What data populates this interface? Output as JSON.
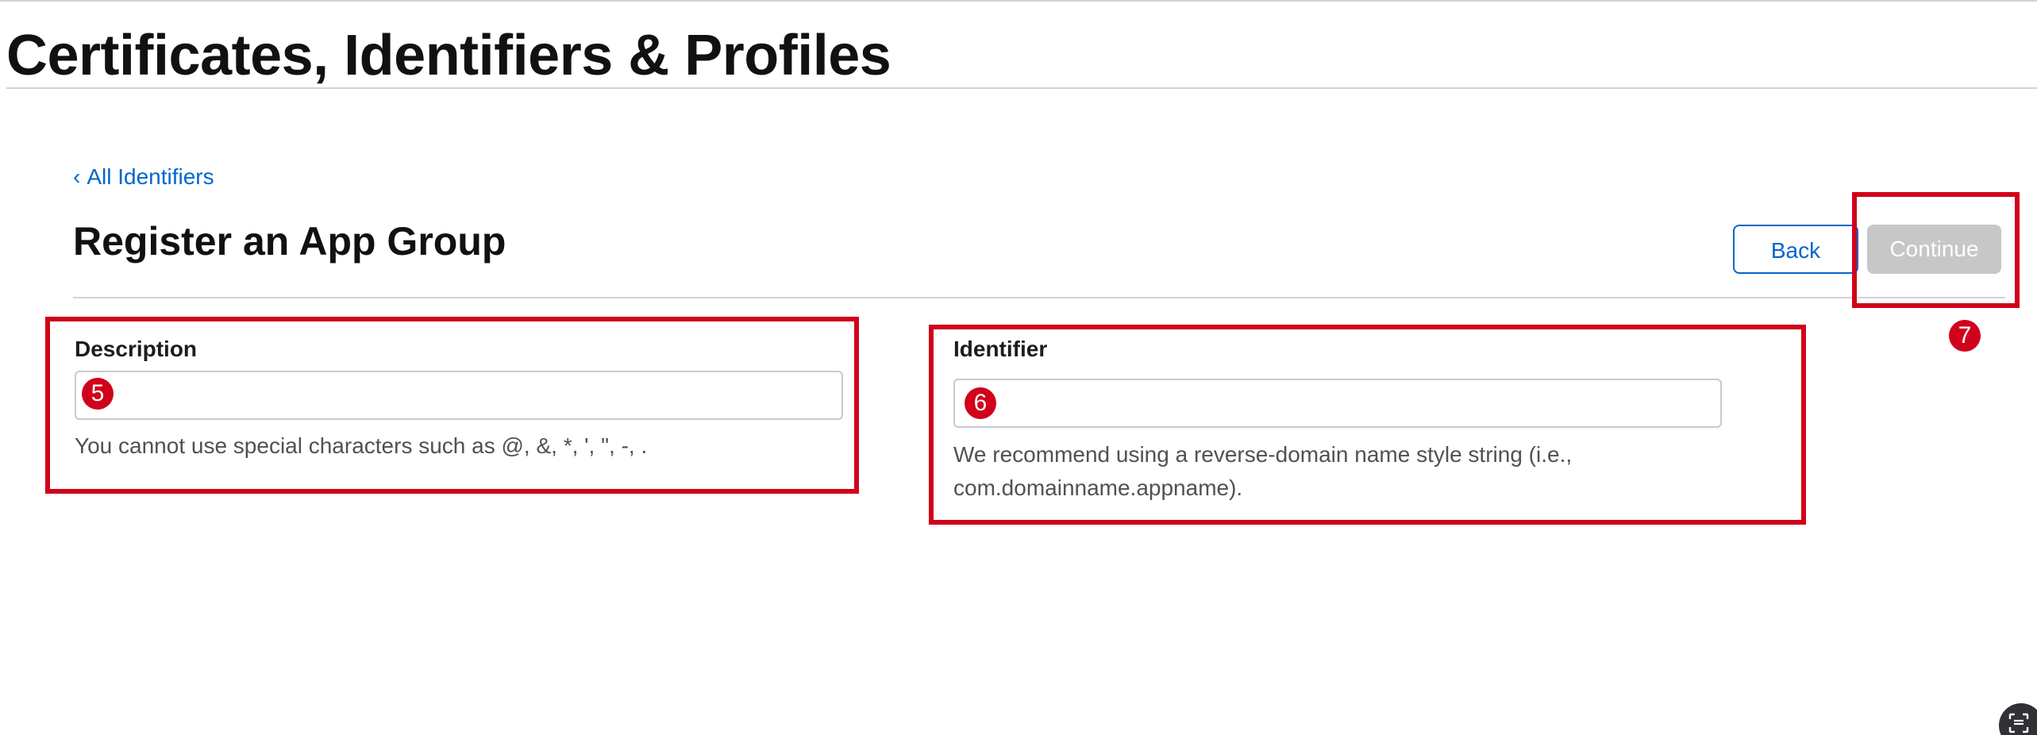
{
  "header": {
    "title": "Certificates, Identifiers & Profiles"
  },
  "nav": {
    "back_link_chevron": "‹",
    "back_link_label": "All Identifiers"
  },
  "page": {
    "title": "Register an App Group",
    "buttons": {
      "back_label": "Back",
      "continue_label": "Continue",
      "continue_state": "disabled"
    }
  },
  "form": {
    "description": {
      "label": "Description",
      "value": "",
      "placeholder": "",
      "help": "You cannot use special characters such as @, &, *, ', \", -, ."
    },
    "identifier": {
      "label": "Identifier",
      "value": "",
      "placeholder": "",
      "help": "We recommend using a reverse-domain name style string (i.e., com.domainname.appname)."
    }
  },
  "annotations": {
    "color": "#d0021b",
    "markers": [
      "5",
      "6",
      "7"
    ]
  },
  "colors": {
    "link": "#0066cc",
    "disabled_button": "#c7c7c7",
    "annotation": "#d0021b"
  },
  "icons": {
    "corner": "screen-capture-icon"
  }
}
